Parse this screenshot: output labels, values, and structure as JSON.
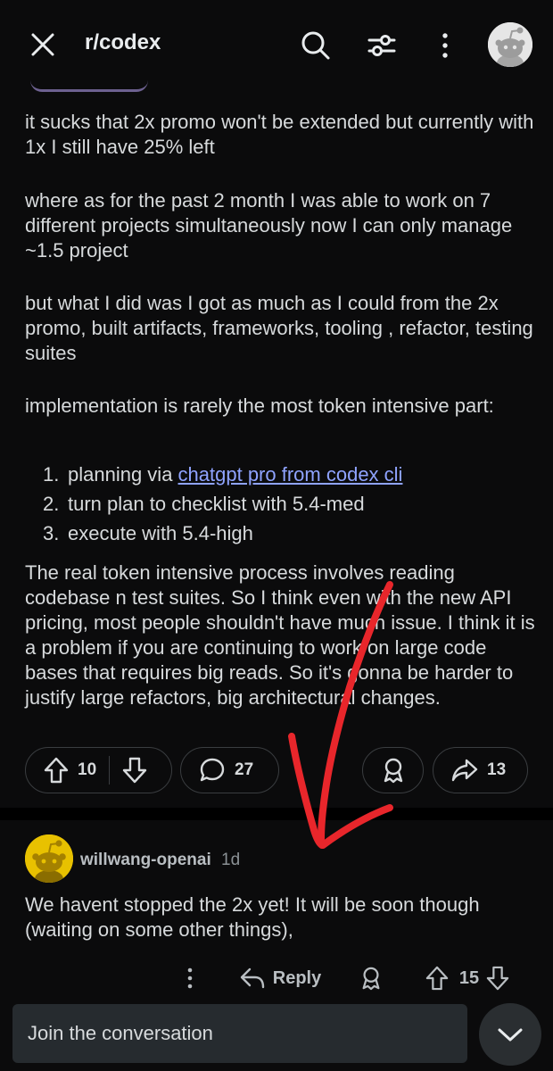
{
  "header": {
    "subreddit": "r/codex",
    "icons": [
      "close-icon",
      "search-icon",
      "filter-icon",
      "more-vertical-icon",
      "user-avatar"
    ]
  },
  "post": {
    "paragraphs": [
      "it sucks that 2x promo won't be extended but currently with 1x I still have 25% left",
      "where as for the past 2 month I was able to work on 7 different projects simultaneously now I can only manage ~1.5 project",
      "but what I did was I got as much as I could from the 2x promo, built artifacts, frameworks, tooling , refactor, testing suites",
      "implementation is rarely the most token intensive part:"
    ],
    "list": [
      {
        "num": "1.",
        "text": "planning via ",
        "link": "chatgpt pro from codex cli"
      },
      {
        "num": "2.",
        "text": "turn plan to checklist with 5.4-med",
        "link": ""
      },
      {
        "num": "3.",
        "text": "execute with 5.4-high",
        "link": ""
      }
    ],
    "closing": "The real token intensive process involves reading codebase n test suites. So I think even with the new API pricing, most people shouldn't have much issue. I think it is a problem if you are continuing to work on large code bases that requires big reads. So it's gonna be harder to justify large refactors, big architectural changes.",
    "upvotes": "10",
    "comments": "27",
    "shares": "13"
  },
  "comment": {
    "author": "willwang-openai",
    "age": "1d",
    "text": "We havent stopped the 2x yet! It will be soon though (waiting on some other things),",
    "reply_label": "Reply",
    "votes": "15"
  },
  "composer": {
    "placeholder": "Join the conversation"
  },
  "colors": {
    "background": "#0b0b0c",
    "text": "#d7dadc",
    "link": "#8fa3ff",
    "annotation_arrow": "#e8262b",
    "comment_avatar": "#e8c100"
  }
}
